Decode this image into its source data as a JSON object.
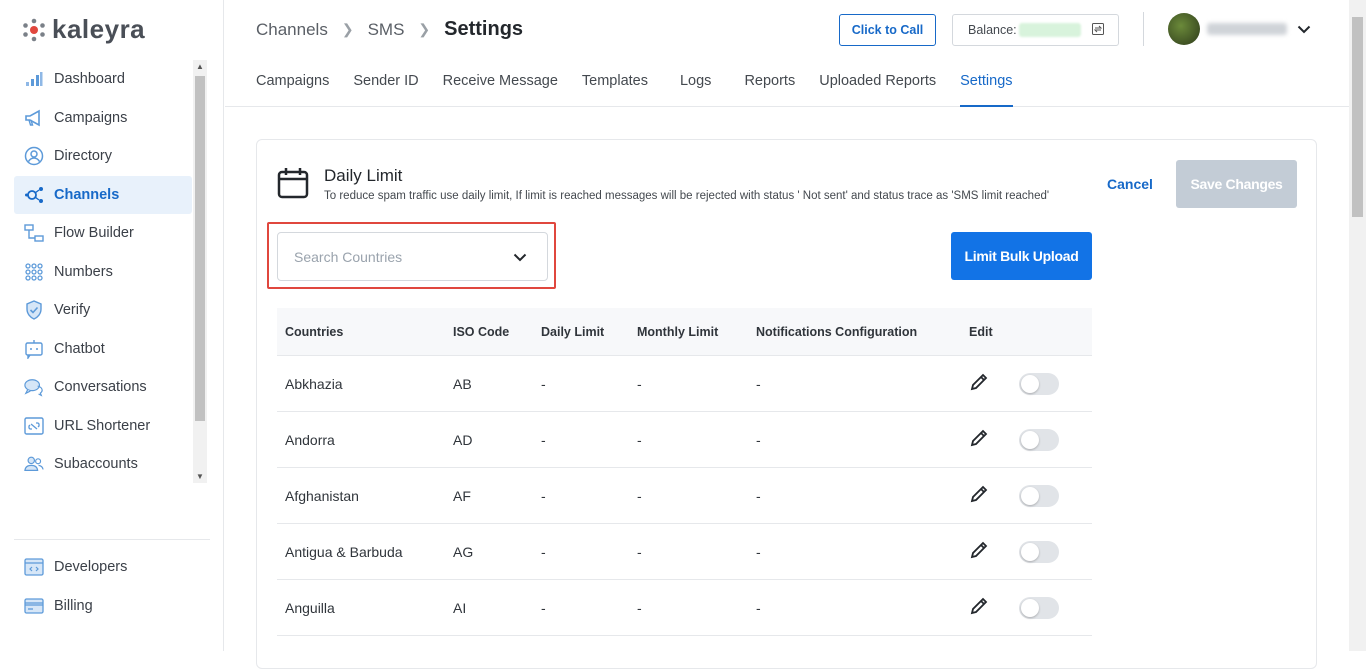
{
  "app": {
    "brand": "kaleyra"
  },
  "sidebar": {
    "items": [
      {
        "label": "Dashboard",
        "icon": "bar-chart-icon"
      },
      {
        "label": "Campaigns",
        "icon": "megaphone-icon"
      },
      {
        "label": "Directory",
        "icon": "user-circle-icon"
      },
      {
        "label": "Channels",
        "icon": "channels-icon",
        "active": true
      },
      {
        "label": "Flow Builder",
        "icon": "flow-icon"
      },
      {
        "label": "Numbers",
        "icon": "dial-pad-icon"
      },
      {
        "label": "Verify",
        "icon": "shield-check-icon"
      },
      {
        "label": "Chatbot",
        "icon": "chatbot-icon"
      },
      {
        "label": "Conversations",
        "icon": "chat-bubbles-icon"
      },
      {
        "label": "URL Shortener",
        "icon": "link-icon"
      },
      {
        "label": "Subaccounts",
        "icon": "users-icon"
      }
    ],
    "bottom": [
      {
        "label": "Developers",
        "icon": "code-icon"
      },
      {
        "label": "Billing",
        "icon": "card-icon"
      }
    ]
  },
  "header": {
    "breadcrumb": [
      "Channels",
      "SMS",
      "Settings"
    ],
    "click_to_call": "Click to Call",
    "balance_label": "Balance:"
  },
  "tabs": [
    "Campaigns",
    "Sender ID",
    "Receive Message",
    "Templates",
    "Logs",
    "Reports",
    "Uploaded Reports",
    "Settings"
  ],
  "active_tab": "Settings",
  "card": {
    "title": "Daily Limit",
    "description": "To reduce spam traffic use daily limit, If limit is reached messages will be rejected with status ' Not sent' and status trace as 'SMS limit reached'",
    "cancel": "Cancel",
    "save": "Save Changes",
    "search_placeholder": "Search Countries",
    "bulk_upload": "Limit Bulk Upload"
  },
  "table": {
    "headers": [
      "Countries",
      "ISO Code",
      "Daily Limit",
      "Monthly Limit",
      "Notifications Configuration",
      "Edit"
    ],
    "rows": [
      {
        "country": "Abkhazia",
        "iso": "AB",
        "daily": "-",
        "monthly": "-",
        "notif": "-"
      },
      {
        "country": "Andorra",
        "iso": "AD",
        "daily": "-",
        "monthly": "-",
        "notif": "-"
      },
      {
        "country": "Afghanistan",
        "iso": "AF",
        "daily": "-",
        "monthly": "-",
        "notif": "-"
      },
      {
        "country": "Antigua & Barbuda",
        "iso": "AG",
        "daily": "-",
        "monthly": "-",
        "notif": "-"
      },
      {
        "country": "Anguilla",
        "iso": "AI",
        "daily": "-",
        "monthly": "-",
        "notif": "-"
      }
    ]
  },
  "colors": {
    "accent": "#1769c8",
    "primary_button": "#1273e6",
    "disabled_button": "#c3ccd6",
    "highlight": "#e0473e"
  }
}
